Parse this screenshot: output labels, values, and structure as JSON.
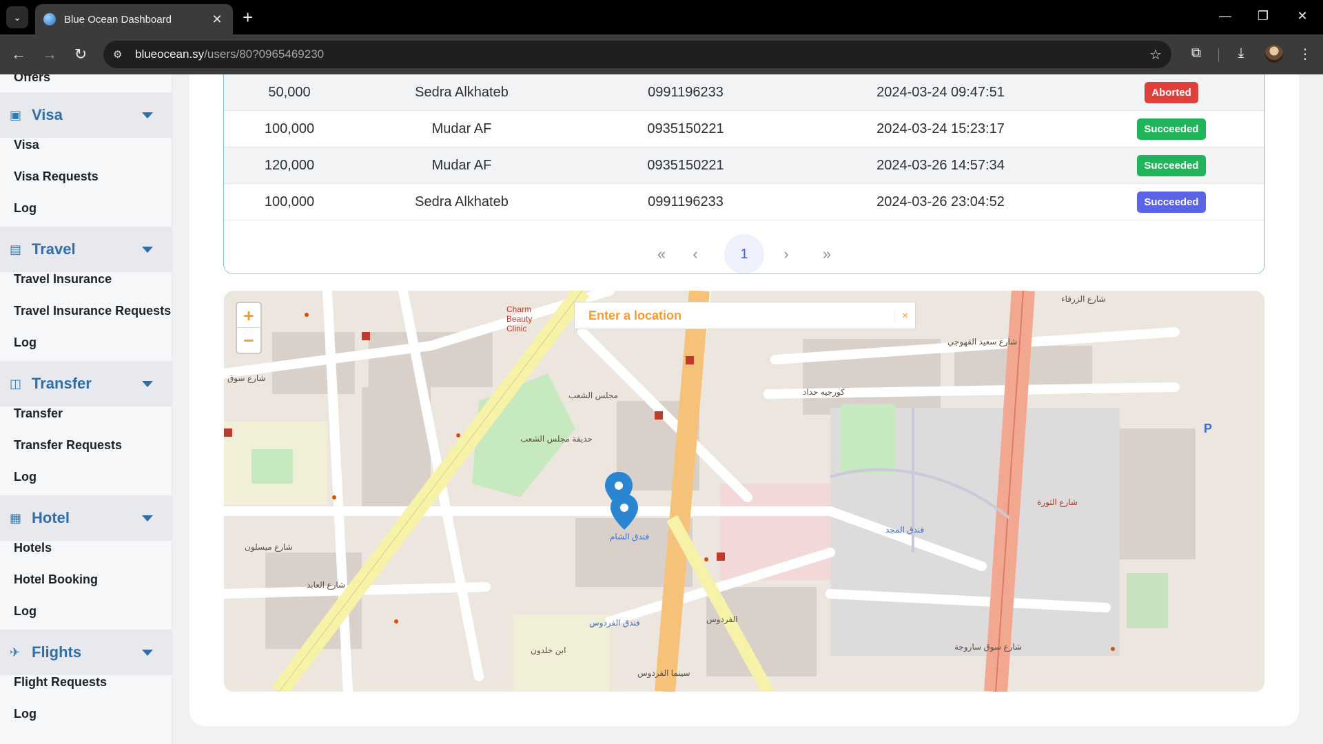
{
  "browser": {
    "tab_title": "Blue Ocean Dashboard",
    "url_host": "blueocean.sy",
    "url_path": "/users/80?0965469230"
  },
  "sidebar": {
    "offers_partial": "Offers",
    "sections": [
      {
        "title": "Visa",
        "icon": "passport-icon",
        "items": [
          "Visa",
          "Visa Requests",
          "Log"
        ]
      },
      {
        "title": "Travel",
        "icon": "luggage-icon",
        "items": [
          "Travel Insurance",
          "Travel Insurance Requests",
          "Log"
        ]
      },
      {
        "title": "Transfer",
        "icon": "bag-icon",
        "items": [
          "Transfer",
          "Transfer Requests",
          "Log"
        ]
      },
      {
        "title": "Hotel",
        "icon": "building-icon",
        "items": [
          "Hotels",
          "Hotel Booking",
          "Log"
        ]
      },
      {
        "title": "Flights",
        "icon": "plane-icon",
        "items": [
          "Flight Requests",
          "Log"
        ]
      }
    ]
  },
  "table": {
    "rows": [
      {
        "amount": "50,000",
        "name": "Sedra Alkhateb",
        "phone": "0991196233",
        "date": "2024-03-24 09:47:51",
        "status": "Aborted",
        "status_color": "#e0403b"
      },
      {
        "amount": "100,000",
        "name": "Mudar AF",
        "phone": "0935150221",
        "date": "2024-03-24 15:23:17",
        "status": "Succeeded",
        "status_color": "#20b55a"
      },
      {
        "amount": "120,000",
        "name": "Mudar AF",
        "phone": "0935150221",
        "date": "2024-03-26 14:57:34",
        "status": "Succeeded",
        "status_color": "#20b55a"
      },
      {
        "amount": "100,000",
        "name": "Sedra Alkhateb",
        "phone": "0991196233",
        "date": "2024-03-26 23:04:52",
        "status": "Succeeded",
        "status_color": "#5b63e6"
      }
    ],
    "pagination": {
      "first": "«",
      "prev": "‹",
      "current": "1",
      "next": "›",
      "last": "»"
    }
  },
  "map": {
    "zoom_in": "+",
    "zoom_out": "−",
    "search_placeholder": "Enter a location",
    "search_clear": "×",
    "labels": {
      "clinic": "Charm Beauty Clinic",
      "street_baghdad": "شارع سعيد القهوجي",
      "street_zarqaa": "شارع الزرقاء",
      "street_maysaloun": "شارع ميسلون",
      "street_firdaws": "الفردوس",
      "street_saroujah": "شارع سوق ساروجة",
      "street_kourjieh": "كورجيه حداد",
      "hotel_sham": "فندق الشام",
      "hotel_majd": "فندق المجد",
      "hotel_firdaws": "فندق الفردوس",
      "park": "حديقة مجلس الشعب",
      "parliament": "مجلس الشعب",
      "cinema": "سينما الفردوس",
      "ibn_khaldoun": "ابن خلدون",
      "street_souq": "شارع سوق",
      "street_abed": "شارع العابد",
      "street_thawra": "شارع الثورة",
      "parking": "P"
    }
  }
}
